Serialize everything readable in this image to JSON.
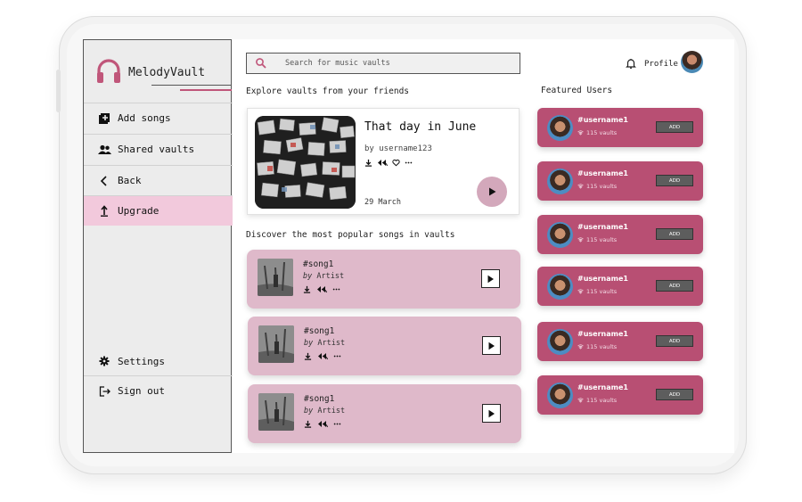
{
  "app": {
    "name": "MelodyVault"
  },
  "sidebar": {
    "items": [
      {
        "label": "Add songs",
        "icon": "add-library-icon"
      },
      {
        "label": "Shared vaults",
        "icon": "people-icon"
      },
      {
        "label": "Back",
        "icon": "chevron-left-icon"
      },
      {
        "label": "Upgrade",
        "icon": "upload-icon",
        "active": true
      }
    ],
    "bottom_items": [
      {
        "label": "Settings",
        "icon": "gear-icon"
      },
      {
        "label": "Sign out",
        "icon": "logout-icon"
      }
    ]
  },
  "search": {
    "placeholder": "Search for music vaults"
  },
  "header": {
    "profile_label": "Profile"
  },
  "explore": {
    "title": "Explore vaults from your friends",
    "vault": {
      "title": "That day in June",
      "by": "by username123",
      "date": "29 March"
    }
  },
  "discover": {
    "title": "Discover the most popular songs in vaults",
    "songs": [
      {
        "title": "#song1",
        "by": "by",
        "artist": "Artist"
      },
      {
        "title": "#song1",
        "by": "by",
        "artist": "Artist"
      },
      {
        "title": "#song1",
        "by": "by",
        "artist": "Artist"
      }
    ]
  },
  "featured": {
    "title": "Featured Users",
    "users": [
      {
        "name": "#username1",
        "vaults": "115 vaults",
        "button": "ADD"
      },
      {
        "name": "#username1",
        "vaults": "115 vaults",
        "button": "ADD"
      },
      {
        "name": "#username1",
        "vaults": "115 vaults",
        "button": "ADD"
      },
      {
        "name": "#username1",
        "vaults": "115 vaults",
        "button": "ADD"
      },
      {
        "name": "#username1",
        "vaults": "115 vaults",
        "button": "ADD"
      },
      {
        "name": "#username1",
        "vaults": "115 vaults",
        "button": "ADD"
      }
    ]
  },
  "colors": {
    "accent": "#b84f73",
    "active_nav": "#f2c9dc",
    "song_card": "#dfb9ca",
    "play_button": "#d3a8bb"
  }
}
